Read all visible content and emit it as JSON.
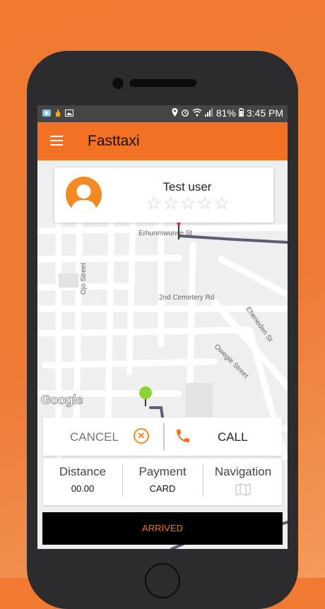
{
  "status_bar": {
    "battery": "81%",
    "time": "3:45 PM"
  },
  "app_bar": {
    "title": "Fasttaxi"
  },
  "rider": {
    "name": "Test user",
    "rating": 0,
    "max_rating": 5
  },
  "map": {
    "labels": {
      "erhunmwunse": "Erhunmwunse St",
      "ojo": "Ojo Street",
      "cemetery": "2nd Cemetery Rd",
      "eheneden": "Eheneden St",
      "owegie": "Owegie Street",
      "google": "Google"
    }
  },
  "actions": {
    "cancel_label": "CANCEL",
    "call_label": "CALL"
  },
  "trip_info": {
    "distance_label": "Distance",
    "distance_value": "00.00",
    "payment_label": "Payment",
    "payment_value": "CARD",
    "navigation_label": "Navigation"
  },
  "arrived_label": "ARRIVED",
  "colors": {
    "accent": "#f37125",
    "status_bar": "#464646",
    "button_dark": "#000000",
    "route": "#5c5c74"
  },
  "icons": {
    "menu": "menu-icon",
    "cancel": "close-circle-icon",
    "call": "phone-icon",
    "navigation": "map-icon",
    "avatar": "user-avatar-icon"
  }
}
